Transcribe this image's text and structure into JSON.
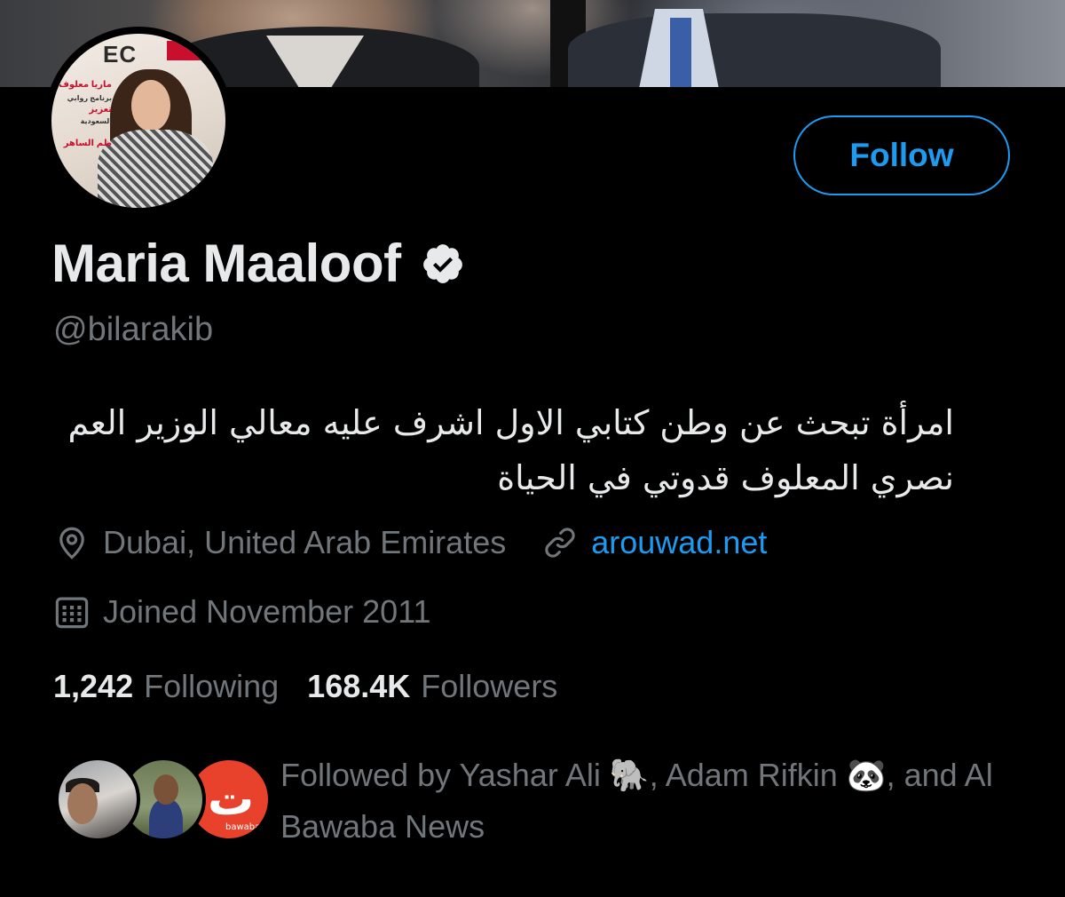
{
  "banner": {
    "alt": ""
  },
  "avatar": {
    "logo_text": "EC",
    "overlay_lines": [
      "ماريا معلوف",
      "برنامج روابي",
      "تعزيز",
      "السعودية",
      "ظم الساهر"
    ]
  },
  "profile": {
    "follow_label": "Follow",
    "display_name": "Maria Maaloof",
    "verified": true,
    "handle": "@bilarakib",
    "bio": "امرأة تبحث عن وطن كتابي الاول اشرف عليه معالي الوزير العم نصري المعلوف قدوتي في الحياة",
    "location": "Dubai, United Arab Emirates",
    "website": "arouwad.net",
    "joined": "Joined November 2011"
  },
  "stats": {
    "following_count": "1,242",
    "following_label": "Following",
    "followers_count": "168.4K",
    "followers_label": "Followers"
  },
  "followed_by": {
    "text": "Followed by Yashar Ali 🐘, Adam Rifkin 🐼, and Al Bawaba News",
    "mini3_glyph": "ت",
    "mini3_small": "bawaba.com"
  },
  "icons": {
    "verified": "verified-badge-icon",
    "location": "location-pin-icon",
    "link": "link-icon",
    "calendar": "calendar-icon"
  },
  "colors": {
    "background": "#000000",
    "accent": "#1d9bf0",
    "text_primary": "#e7e9ea",
    "text_secondary": "#71767b"
  }
}
